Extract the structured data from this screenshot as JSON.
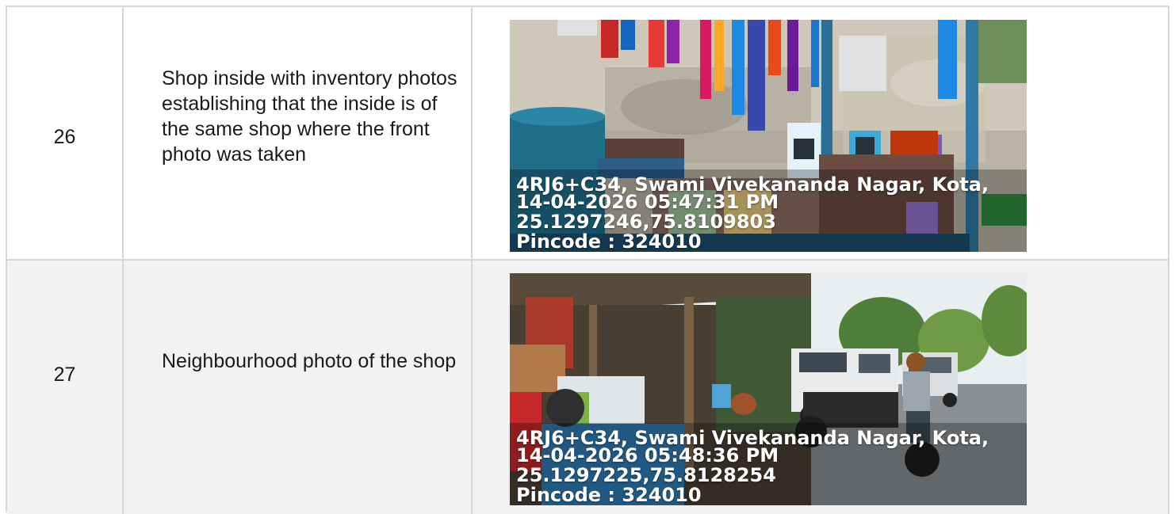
{
  "rows": [
    {
      "number": "26",
      "description": "Shop inside with inventory photos establishing that the inside is of the same shop where the front photo was taken",
      "photo": {
        "kind": "shop-interior-photo",
        "address": "4RJ6+C34, Swami Vivekananda Nagar, Kota,",
        "datetime": "14-04-2026 05:47:31 PM",
        "coords": "25.1297246,75.8109803",
        "pincode": "Pincode : 324010"
      }
    },
    {
      "number": "27",
      "description": "Neighbourhood photo of the shop",
      "photo": {
        "kind": "neighbourhood-photo",
        "address": "4RJ6+C34, Swami Vivekananda Nagar, Kota,",
        "datetime": "14-04-2026 05:48:36 PM",
        "coords": "25.1297225,75.8128254",
        "pincode": "Pincode : 324010"
      }
    }
  ]
}
